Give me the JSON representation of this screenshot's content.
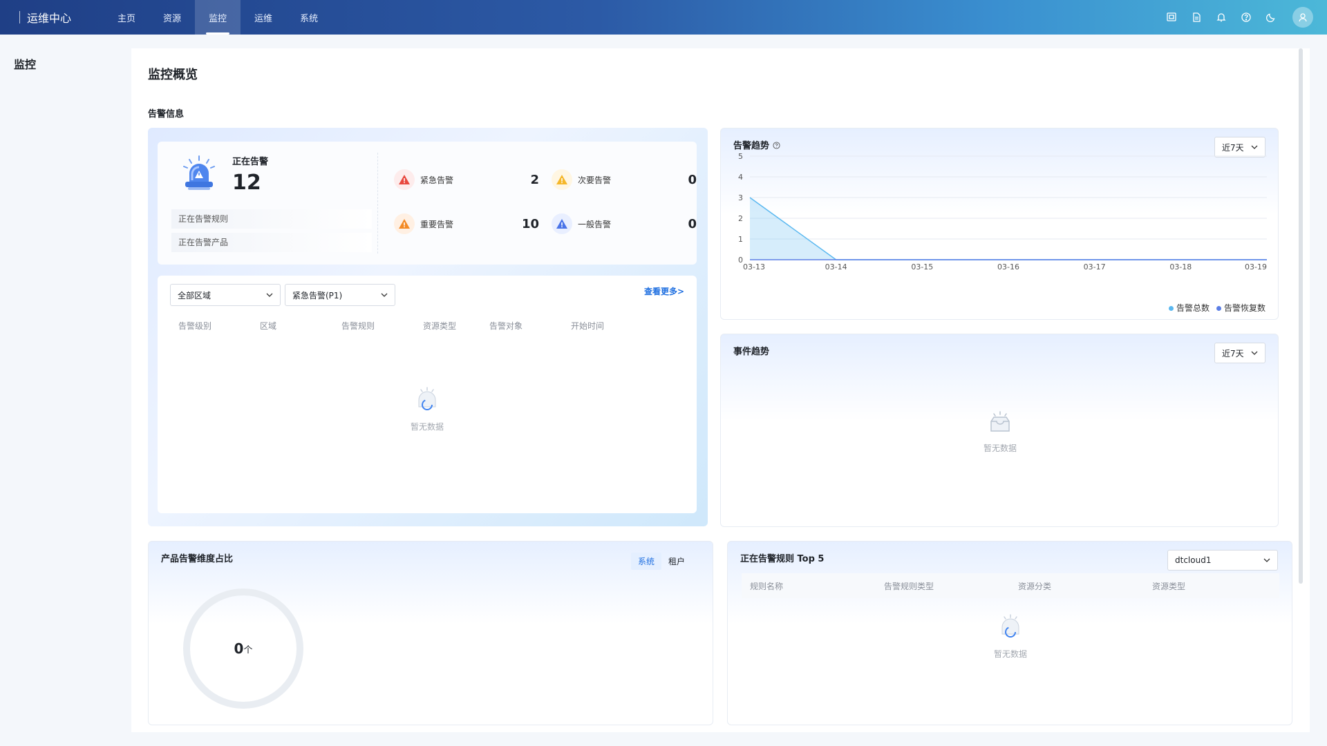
{
  "app": {
    "title": "运维中心"
  },
  "nav": [
    {
      "label": "主页",
      "active": false
    },
    {
      "label": "资源",
      "active": false
    },
    {
      "label": "监控",
      "active": true
    },
    {
      "label": "运维",
      "active": false
    },
    {
      "label": "系统",
      "active": false
    }
  ],
  "sidebar": {
    "title": "监控"
  },
  "page": {
    "title": "监控概览",
    "section": "告警信息"
  },
  "alarm": {
    "active_label": "正在告警",
    "active_count": "12",
    "rules_link": "正在告警规则",
    "products_link": "正在告警产品",
    "levels": [
      {
        "name": "紧急告警",
        "value": "2",
        "color": "#e8483f",
        "bg": "#fdecec"
      },
      {
        "name": "次要告警",
        "value": "0",
        "color": "#f5b72a",
        "bg": "#fff6e2"
      },
      {
        "name": "重要告警",
        "value": "10",
        "color": "#f38a25",
        "bg": "#fff0e3"
      },
      {
        "name": "一般告警",
        "value": "0",
        "color": "#4a74e8",
        "bg": "#e9efff"
      }
    ],
    "filter_region": "全部区域",
    "filter_level": "紧急告警(P1)",
    "more": "查看更多>",
    "columns": [
      "告警级别",
      "区域",
      "告警规则",
      "资源类型",
      "告警对象",
      "开始时间"
    ],
    "empty": "暂无数据"
  },
  "trend": {
    "title": "告警趋势",
    "period": "近7天",
    "legend": [
      {
        "name": "告警总数",
        "color": "#5ab8f0"
      },
      {
        "name": "告警恢复数",
        "color": "#5b7ee5"
      }
    ]
  },
  "chart_data": {
    "type": "area",
    "x": [
      "03-13",
      "03-14",
      "03-15",
      "03-16",
      "03-17",
      "03-18",
      "03-19"
    ],
    "series": [
      {
        "name": "告警总数",
        "values": [
          3,
          0,
          0,
          0,
          0,
          0,
          0
        ]
      },
      {
        "name": "告警恢复数",
        "values": [
          0,
          0,
          0,
          0,
          0,
          0,
          0
        ]
      }
    ],
    "yticks": [
      "0",
      "1",
      "2",
      "3",
      "4",
      "5"
    ],
    "ylim": [
      0,
      5
    ],
    "grid": true,
    "legend_position": "bottom-right"
  },
  "events": {
    "title": "事件趋势",
    "period": "近7天",
    "empty": "暂无数据"
  },
  "product": {
    "title": "产品告警维度占比",
    "tab_system": "系统",
    "tab_tenant": "租户",
    "total": "0",
    "unit": "个"
  },
  "top5": {
    "title": "正在告警规则 Top 5",
    "select": "dtcloud1",
    "columns": [
      "规则名称",
      "告警规则类型",
      "资源分类",
      "资源类型"
    ],
    "empty": "暂无数据"
  },
  "icons": [
    "screen-icon",
    "document-icon",
    "bell-icon",
    "help-icon",
    "moon-icon",
    "user-icon"
  ]
}
